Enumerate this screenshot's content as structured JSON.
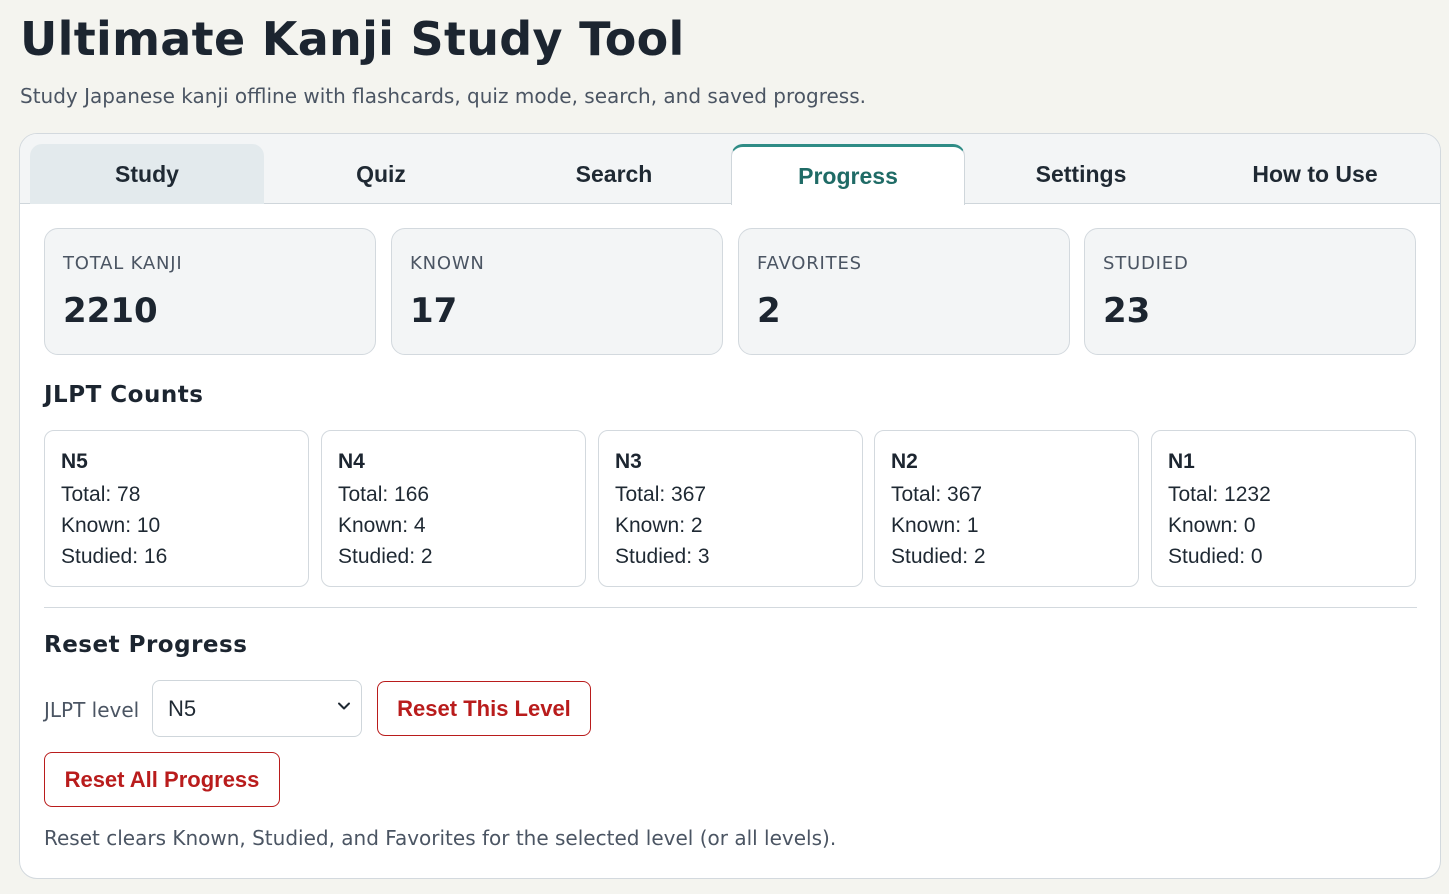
{
  "header": {
    "title": "Ultimate Kanji Study Tool",
    "subtitle": "Study Japanese kanji offline with flashcards, quiz mode, search, and saved progress."
  },
  "tabs": [
    {
      "label": "Study"
    },
    {
      "label": "Quiz"
    },
    {
      "label": "Search"
    },
    {
      "label": "Progress"
    },
    {
      "label": "Settings"
    },
    {
      "label": "How to Use"
    }
  ],
  "stats": [
    {
      "label": "TOTAL KANJI",
      "value": "2210"
    },
    {
      "label": "KNOWN",
      "value": "17"
    },
    {
      "label": "FAVORITES",
      "value": "2"
    },
    {
      "label": "STUDIED",
      "value": "23"
    }
  ],
  "jlpt": {
    "title": "JLPT Counts",
    "levels": [
      {
        "name": "N5",
        "total": "Total: 78",
        "known": "Known: 10",
        "studied": "Studied: 16"
      },
      {
        "name": "N4",
        "total": "Total: 166",
        "known": "Known: 4",
        "studied": "Studied: 2"
      },
      {
        "name": "N3",
        "total": "Total: 367",
        "known": "Known: 2",
        "studied": "Studied: 3"
      },
      {
        "name": "N2",
        "total": "Total: 367",
        "known": "Known: 1",
        "studied": "Studied: 2"
      },
      {
        "name": "N1",
        "total": "Total: 1232",
        "known": "Known: 0",
        "studied": "Studied: 0"
      }
    ]
  },
  "reset": {
    "title": "Reset Progress",
    "level_label": "JLPT level",
    "selected_level": "N5",
    "reset_level_label": "Reset This Level",
    "reset_all_label": "Reset All Progress",
    "help": "Reset clears Known, Studied, and Favorites for the selected level (or all levels)."
  },
  "colors": {
    "accent": "#2f8c86",
    "active_tab_text": "#1f6b66",
    "danger": "#b91c1c"
  }
}
